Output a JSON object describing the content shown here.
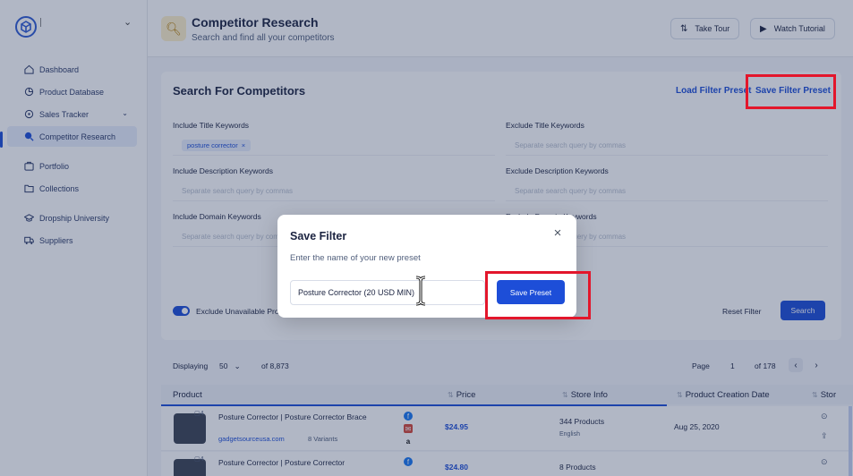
{
  "sidebar": {
    "items": [
      {
        "label": "Dashboard",
        "icon": "home-icon"
      },
      {
        "label": "Product Database",
        "icon": "database-icon"
      },
      {
        "label": "Sales Tracker",
        "icon": "target-icon"
      },
      {
        "label": "Competitor Research",
        "icon": "search-icon"
      },
      {
        "label": "Portfolio",
        "icon": "briefcase-icon"
      },
      {
        "label": "Collections",
        "icon": "folder-icon"
      },
      {
        "label": "Dropship University",
        "icon": "graduation-cap-icon"
      },
      {
        "label": "Suppliers",
        "icon": "truck-icon"
      }
    ],
    "active_item": "Competitor Research"
  },
  "header": {
    "title": "Competitor Research",
    "subtitle": "Search and find all your competitors",
    "take_tour": "Take Tour",
    "watch_tutorial": "Watch Tutorial"
  },
  "search": {
    "title": "Search For Competitors",
    "load_preset": "Load Filter Preset",
    "save_preset": "Save Filter Preset",
    "include_title_label": "Include Title Keywords",
    "include_title_chip": "posture corrector",
    "chip_remove": "×",
    "exclude_title_label": "Exclude Title Keywords",
    "include_desc_label": "Include Description Keywords",
    "exclude_desc_label": "Exclude Description Keywords",
    "include_domain_label": "Include Domain Keywords",
    "exclude_domain_label": "Exclude Domain Keywords",
    "placeholder": "Separate search query by commas",
    "exclude_unavailable": "Exclude Unavailable Products",
    "reset": "Reset Filter",
    "search": "Search"
  },
  "results": {
    "displaying": "Displaying",
    "per_page": "50",
    "total": "of 8,873",
    "page_label": "Page",
    "page": "1",
    "page_total": "of 178",
    "columns": [
      "Product",
      "Price",
      "Store Info",
      "Product Creation Date",
      "Stor"
    ],
    "rows": [
      {
        "badge": "4",
        "name": "Posture Corrector | Posture Corrector Brace",
        "url": "gadgetsourceusa.com",
        "variants": "8 Variants",
        "price": "$24.95",
        "store": "344 Products",
        "lang": "English",
        "date": "Aug 25, 2020"
      },
      {
        "badge": "4",
        "name": "Posture Corrector | Posture Corrector",
        "url": "",
        "variants": "",
        "price": "$24.80",
        "store": "8 Products",
        "lang": "",
        "date": ""
      }
    ]
  },
  "modal": {
    "title": "Save Filter",
    "subtitle": "Enter the name of your new preset",
    "input_value": "Posture Corrector (20 USD MIN)",
    "save_button": "Save Preset",
    "close": "×"
  },
  "colors": {
    "accent": "#1d4ed8",
    "highlight": "#e3162b"
  }
}
